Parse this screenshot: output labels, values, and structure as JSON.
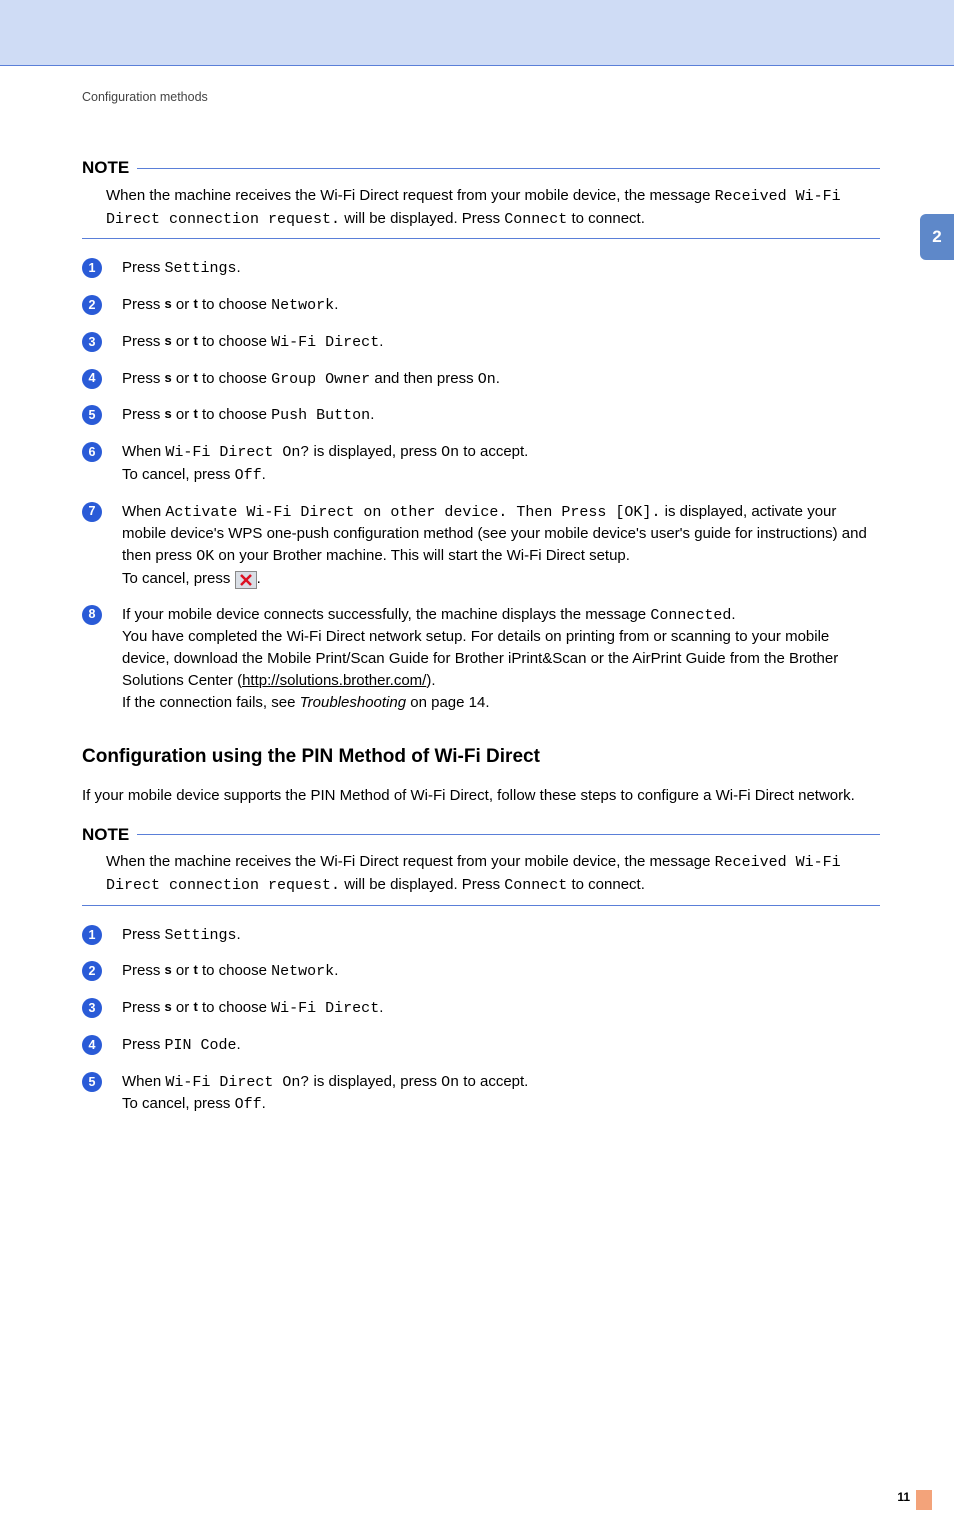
{
  "breadcrumb": "Configuration methods",
  "pageTab": "2",
  "pageNumber": "11",
  "note1": {
    "label": "NOTE",
    "text_a": "When the machine receives the Wi-Fi Direct request from your mobile device, the message ",
    "mono": "Received Wi-Fi Direct connection request.",
    "text_b": " will be displayed. Press ",
    "connect": "Connect",
    "text_c": " to connect."
  },
  "stepsA": {
    "s1_a": "Press ",
    "s1_m": "Settings",
    "s1_b": ".",
    "s2_a": "Press ",
    "s2_b": " or ",
    "s2_c": " to choose ",
    "s2_m": "Network",
    "s2_d": ".",
    "s3_a": "Press ",
    "s3_b": " or ",
    "s3_c": " to choose ",
    "s3_m": "Wi-Fi Direct",
    "s3_d": ".",
    "s4_a": "Press ",
    "s4_b": " or ",
    "s4_c": " to choose ",
    "s4_m": "Group Owner",
    "s4_d": " and then press ",
    "s4_m2": "On",
    "s4_e": ".",
    "s5_a": "Press ",
    "s5_b": " or ",
    "s5_c": " to choose ",
    "s5_m": "Push Button",
    "s5_d": ".",
    "s6_a": "When ",
    "s6_m": "Wi-Fi Direct On?",
    "s6_b": " is displayed, press ",
    "s6_m2": "On",
    "s6_c": " to accept.",
    "s6_d": "To cancel, press ",
    "s6_m3": "Off",
    "s6_e": ".",
    "s7_a": "When ",
    "s7_m": "Activate Wi-Fi Direct on other device. Then Press [OK].",
    "s7_b": " is displayed, activate your mobile device's WPS one-push configuration method (see your mobile device's user's guide for instructions) and then press ",
    "s7_m2": "OK",
    "s7_c": " on your Brother machine. This will start the Wi-Fi Direct setup.",
    "s7_d": "To cancel, press ",
    "s7_e": ".",
    "s8_a": "If your mobile device connects successfully, the machine displays the message ",
    "s8_m": "Connected",
    "s8_b": ".",
    "s8_c": "You have completed the Wi-Fi Direct network setup. For details on printing from or scanning to your mobile device, download the Mobile Print/Scan Guide for Brother iPrint&Scan or the AirPrint Guide from the Brother Solutions Center (",
    "s8_link": "http://solutions.brother.com/",
    "s8_d": ").",
    "s8_e": "If the connection fails, see ",
    "s8_it": "Troubleshooting",
    "s8_f": " on page 14."
  },
  "sectionTitle": "Configuration using the PIN Method of Wi-Fi Direct",
  "sectionIntro": "If your mobile device supports the PIN Method of Wi-Fi Direct, follow these steps to configure a Wi-Fi Direct network.",
  "note2": {
    "label": "NOTE",
    "text_a": "When the machine receives the Wi-Fi Direct request from your mobile device, the message ",
    "mono": "Received Wi-Fi Direct connection request.",
    "text_b": " will be displayed. Press ",
    "connect": "Connect",
    "text_c": " to connect."
  },
  "stepsB": {
    "s1_a": "Press ",
    "s1_m": "Settings",
    "s1_b": ".",
    "s2_a": "Press ",
    "s2_b": " or ",
    "s2_c": " to choose ",
    "s2_m": "Network",
    "s2_d": ".",
    "s3_a": "Press ",
    "s3_b": " or ",
    "s3_c": " to choose ",
    "s3_m": "Wi-Fi Direct",
    "s3_d": ".",
    "s4_a": "Press ",
    "s4_m": "PIN Code",
    "s4_b": ".",
    "s5_a": "When ",
    "s5_m": "Wi-Fi Direct On?",
    "s5_b": " is displayed, press ",
    "s5_m2": "On",
    "s5_c": " to accept.",
    "s5_d": "To cancel, press ",
    "s5_m3": "Off",
    "s5_e": "."
  },
  "glyphs": {
    "up": "s",
    "down": "t"
  }
}
